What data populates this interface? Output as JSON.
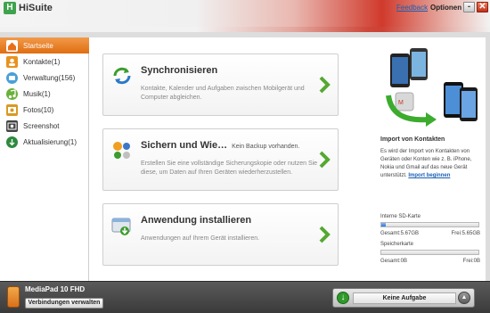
{
  "app": {
    "title": "HiSuite",
    "logo": "hisuite-logo-icon"
  },
  "header": {
    "feedback": "Feedback",
    "options": "Optionen",
    "minimize": "-",
    "close": "✕"
  },
  "sidebar": {
    "items": [
      {
        "label": "Startseite",
        "icon": "home-icon",
        "color": "#e96f16"
      },
      {
        "label": "Kontakte(1)",
        "icon": "contacts-icon",
        "color": "#e8921e"
      },
      {
        "label": "Verwaltung(156)",
        "icon": "messages-icon",
        "color": "#4aa0d8"
      },
      {
        "label": "Musik(1)",
        "icon": "music-icon",
        "color": "#6ab23a"
      },
      {
        "label": "Fotos(10)",
        "icon": "photos-icon",
        "color": "#d89a22"
      },
      {
        "label": "Screenshot",
        "icon": "screenshot-icon",
        "color": "#444444"
      },
      {
        "label": "Aktualisierung(1)",
        "icon": "update-icon",
        "color": "#2e8a3e"
      }
    ]
  },
  "cards": [
    {
      "title": "Synchronisieren",
      "note": "",
      "desc": "Kontakte, Kalender und Aufgaben zwischen Mobilgerät und Computer abgleichen.",
      "icon": "sync-icon"
    },
    {
      "title": "Sichern und Wie…",
      "note": "Kein Backup vorhanden.",
      "desc": "Erstellen Sie eine vollständige Sicherungskopie oder nutzen Sie diese, um Daten auf Ihren Geräten wiederherzustellen.",
      "icon": "backup-icon"
    },
    {
      "title": "Anwendung installieren",
      "note": "",
      "desc": "Anwendungen auf Ihrem Gerät installieren.",
      "icon": "install-app-icon"
    }
  ],
  "import": {
    "title": "Import von Kontakten",
    "text": "Es wird der Import von Kontakten von Geräten oder Konten wie z. B. iPhone, Nokia und Gmail auf das neue Gerät unterstützt.",
    "link": "Import beginnen"
  },
  "storage": {
    "internal": {
      "label": "Interne SD-Karte",
      "total": "Gesamt:5.67GB",
      "free": "Frei:5.65GB",
      "used_fraction": 0.05
    },
    "memory": {
      "label": "Speicherkarte",
      "total": "Gesamt:0B",
      "free": "Frei:0B",
      "used_fraction": 0
    }
  },
  "bottom": {
    "device_name": "MediaPad 10 FHD",
    "connect_button": "Verbindungen verwalten",
    "task_label": "Keine Aufgabe"
  },
  "colors": {
    "accent": "#e96f16",
    "link": "#1a5fb4",
    "bar_fill": "#2f78d8"
  }
}
